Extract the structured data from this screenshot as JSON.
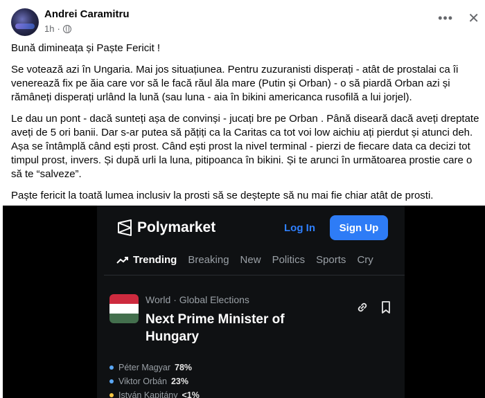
{
  "post": {
    "author": "Andrei Caramitru",
    "time": "1h",
    "separator": "·",
    "paragraphs": [
      "Bună dimineața și Paște Fericit !",
      "Se votează azi în Ungaria. Mai jos situațiunea. Pentru zuzuranisti disperați - atât de prostalai ca îi venerează fix pe ăia care vor să le facă răul ăla mare (Putin și Orban) - o să piardă Orban azi și rămâneți disperați urlând la lună (sau luna - aia în bikini americanca rusofilă a lui jorjel).",
      "Le dau un pont - dacă sunteți așa de convinși - jucați bre pe Orban . Până diseară dacă aveți dreptate aveți de 5 ori banii. Dar s-ar putea să pățiți ca la Caritas ca tot voi low aichiu ați pierdut și atunci deh. Așa se întâmplă când ești prost. Când ești prost la nivel terminal - pierzi de fiecare data ca decizi tot timpul prost, invers. Și după urli la luna, pitipoanca în bikini. Și te arunci în următoarea prostie care o să te “salveze”.",
      "Paște fericit la toată lumea inclusiv la prosti să se deștepte să nu mai fie chiar atât de prosti."
    ]
  },
  "polymarket": {
    "brand": "Polymarket",
    "login": "Log In",
    "signup": "Sign Up",
    "nav": [
      "Trending",
      "Breaking",
      "New",
      "Politics",
      "Sports",
      "Cry"
    ],
    "category": "World · Global Elections",
    "title": "Next Prime Minister of Hungary",
    "outcomes": [
      {
        "name": "Péter Magyar",
        "pct": "78%",
        "color": "#5aa7f5"
      },
      {
        "name": "Viktor Orbán",
        "pct": "23%",
        "color": "#5aa7f5"
      },
      {
        "name": "István Kapitány",
        "pct": "<1%",
        "color": "#f5c542"
      }
    ],
    "flag_colors": [
      "#cd2a3e",
      "#ffffff",
      "#436f4d"
    ]
  }
}
